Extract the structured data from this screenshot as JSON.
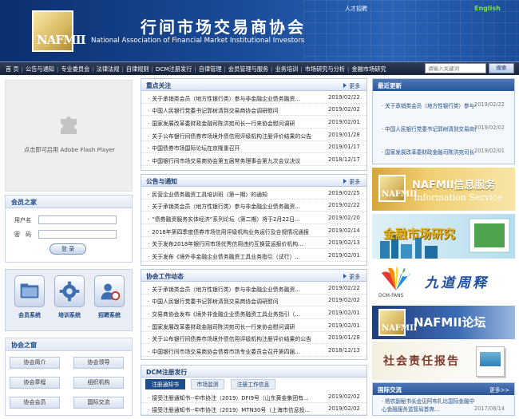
{
  "header": {
    "title_cn": "行间市场交易商协会",
    "title_en": "National Association of Financial Market Institutional Investors",
    "logo_text": "NAFMII",
    "recruit": "人才招聘",
    "english": "English"
  },
  "nav": {
    "items": [
      "首 页",
      "公告与通知",
      "专业委员会",
      "法律法规",
      "自律规则",
      "DCM注册发行",
      "自律管理",
      "会员管理与服务",
      "业务培训",
      "市场研究与分析",
      "金融市场研究"
    ],
    "search_placeholder": "请输入关键词",
    "search_button": "搜索"
  },
  "flash": {
    "text": "点击即可启用 Adobe Flash Player"
  },
  "member": {
    "title": "会员之家",
    "username_label": "用户名",
    "password_label": "密　码",
    "login_button": "登 录"
  },
  "systems": [
    {
      "label": "会员系统"
    },
    {
      "label": "培训系统"
    },
    {
      "label": "招聘系统"
    }
  ],
  "assoc": {
    "title": "协会之窗",
    "buttons": [
      "协会简介",
      "协会领导",
      "协会章程",
      "组织机构",
      "协会会员",
      "国际交流"
    ]
  },
  "panel_more": "更多",
  "focus": {
    "title": "重点关注",
    "rows": [
      {
        "t": "关于承销类会员（地方性银行类）参与非金融企业债务融资...",
        "d": "2019/02/22"
      },
      {
        "t": "中国人民银行党委书记郭树清到交易商协会调研慰问",
        "d": "2019/02/02"
      },
      {
        "t": "国家发展改革委财政金融司陈洪宛司长一行来协会慰问调研",
        "d": "2019/02/01"
      },
      {
        "t": "关于公布银行间债券市场境外债信用评级机构注册评价结果的公告",
        "d": "2019/01/28"
      },
      {
        "t": "中国债券市场国际论坛在京隆重召开",
        "d": "2019/01/17"
      },
      {
        "t": "中国银行间市场交易商协会第五届常务理事会第九次会议决议",
        "d": "2018/12/17"
      }
    ]
  },
  "notice": {
    "title": "公告与通知",
    "rows": [
      {
        "t": "民营企业债务融资工具培训班（第一期）的通知",
        "d": "2019/02/25"
      },
      {
        "t": "关于承销类会员（地方性银行类）参与非金融企业债务融资...",
        "d": "2019/02/22"
      },
      {
        "t": "“债券融资服务实体经济”系列论坛（第二期）将于2月22日...",
        "d": "2019/02/20"
      },
      {
        "t": "2018年第四季度债券市场信用评级机构业务运行及合规情况通报",
        "d": "2019/02/14"
      },
      {
        "t": "关于发布2018年银行间市场优秀信用违约互换营运报价机构...",
        "d": "2019/02/13"
      },
      {
        "t": "关于发布《境外非金融企业债务融资工具业务指引（试行）...",
        "d": "2019/02/01"
      }
    ]
  },
  "work": {
    "title": "协会工作动态",
    "rows": [
      {
        "t": "关于承销类会员（地方性银行类）参与非金融企业债务融资...",
        "d": "2019/02/22"
      },
      {
        "t": "中国人民银行党委书记郭树清到交易商协会调研慰问",
        "d": "2019/02/02"
      },
      {
        "t": "交易商协会发布《境外非金融企业债务融资工具业务指引（...",
        "d": "2019/02/01"
      },
      {
        "t": "国家发展改革委财政金融司陈洪宛司长一行来协会慰问调研",
        "d": "2019/02/01"
      },
      {
        "t": "关于公布银行间债券市场境外债信用评级机构注册评价结果的公告",
        "d": "2019/01/28"
      },
      {
        "t": "中国银行间市场交易商协会债券市场专业委员会召开第四届...",
        "d": "2018/12/13"
      }
    ]
  },
  "dcm": {
    "title": "DCM注册发行",
    "tabs": [
      "注册通知书",
      "市场监测",
      "注册工作信息"
    ],
    "rows": [
      {
        "t": "接受注册通知书--中市协注（2019）DFI9号（山东黄金集团有...",
        "d": "2019/02/02"
      },
      {
        "t": "接受注册通知书--中市协注（2019）MTN30号（上海市信息投...",
        "d": "2019/02/02"
      }
    ]
  },
  "news": {
    "title": "最近更新",
    "rows": [
      {
        "t": "关于承销类会员（地方性银行类）参与非金融企业债务融资...",
        "d": "2019/02/22"
      },
      {
        "t": "中国人民银行党委书记郭树清到交易商协会调研慰问",
        "d": "2019/02/02"
      },
      {
        "t": "国家发展改革委财政金融司陈洪宛司长一行来协会慰问调研",
        "d": "2019/02/01"
      }
    ]
  },
  "banners": {
    "b1": "NAFMII信息服务",
    "b1_sub": "Information Service",
    "b2": "金融市场研究",
    "b3": "九道周释",
    "b3_sub": "DCM-FANS",
    "b4": "NAFMII论坛",
    "b5": "社会责任报告"
  },
  "intl": {
    "title": "国际交流",
    "more": "更多>>",
    "rows": [
      {
        "t": "杨农副秘书长会见阿布扎比国际金融中心金融服务监管局首席...",
        "d": "2017/08/14"
      }
    ]
  },
  "colors": {
    "brand": "#1e4c8c",
    "header_bg": "#0b2f6f",
    "english": "#7ee04a"
  }
}
